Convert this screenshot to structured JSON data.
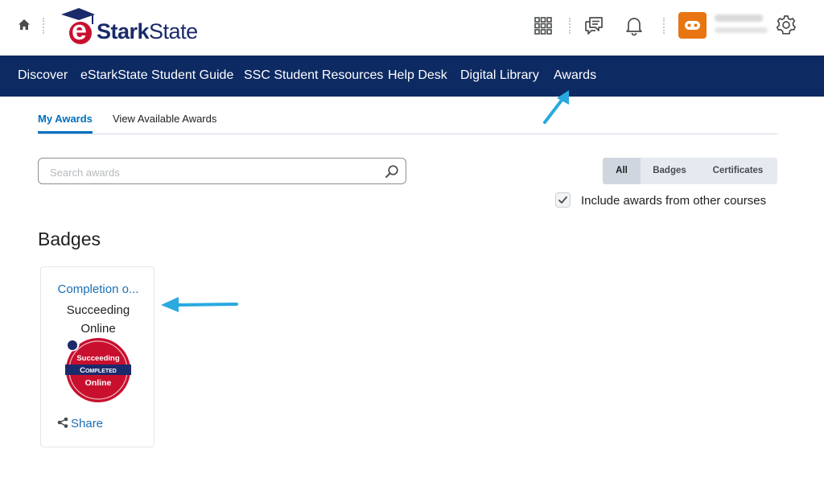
{
  "brand": {
    "logo_e": "e",
    "logo_stark": "Stark",
    "logo_state": "State"
  },
  "nav": {
    "items": [
      "Discover",
      "eStarkState Student Guide",
      "SSC Student Resources",
      "Help Desk",
      "Digital Library",
      "Awards"
    ]
  },
  "tabs": {
    "my_awards": "My Awards",
    "view_available": "View Available Awards"
  },
  "search": {
    "placeholder": "Search awards",
    "value": ""
  },
  "filter": {
    "all": "All",
    "badges": "Badges",
    "certificates": "Certificates",
    "selected": "All"
  },
  "include_other": {
    "label": "Include awards from other courses",
    "checked": true
  },
  "section_title": "Badges",
  "award": {
    "title": "Completion o...",
    "subtitle": "Succeeding Online",
    "badge_top": "Succeeding",
    "badge_mid": "Completed",
    "badge_bottom": "Online",
    "share_label": "Share"
  },
  "colors": {
    "navbar": "#0d2a63",
    "accent": "#006fbf",
    "avatar": "#e87511",
    "badge_red": "#c8102e",
    "arrow": "#29a9e0"
  }
}
